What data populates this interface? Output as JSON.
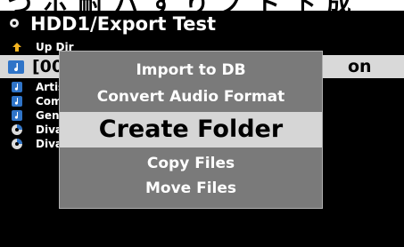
{
  "banner": {
    "text": "つ ホ 耐 ハ す り ノ ト 下 成"
  },
  "header": {
    "path_title": "HDD1/Export Test"
  },
  "file_list": {
    "items": [
      {
        "label": "Up Dir",
        "icon": "up-arrow-icon"
      },
      {
        "label": "[00",
        "trailing": "on",
        "icon": "folder-music-icon",
        "selected": true
      },
      {
        "label": "Artis",
        "icon": "music-note-icon"
      },
      {
        "label": "Com",
        "icon": "music-note-icon"
      },
      {
        "label": "Gen",
        "icon": "music-note-icon"
      },
      {
        "label": "Diva",
        "icon": "cd-icon"
      },
      {
        "label": "Diva",
        "icon": "cd-icon"
      }
    ]
  },
  "context_menu": {
    "items": [
      {
        "label": "Import to DB",
        "highlighted": false
      },
      {
        "label": "Convert Audio Format",
        "highlighted": false
      },
      {
        "label": "Create Folder",
        "highlighted": true
      },
      {
        "label": "Copy Files",
        "highlighted": false
      },
      {
        "label": "Move Files",
        "highlighted": false
      }
    ]
  },
  "colors": {
    "screen_bg": "#000000",
    "popup_bg": "#7a7a7a",
    "highlight_bg": "#d6d6d6",
    "icon_blue": "#2f74c8",
    "up_arrow": "#f2b320"
  }
}
